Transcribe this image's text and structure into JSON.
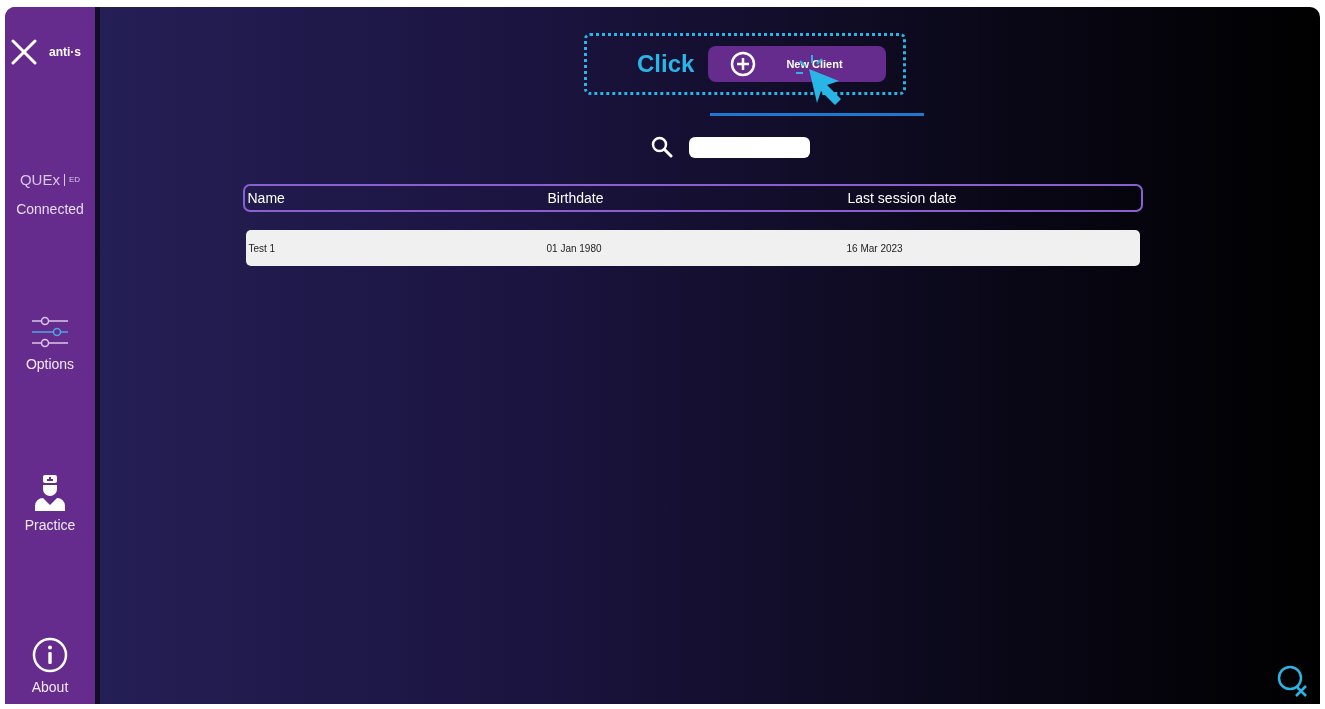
{
  "sidebar": {
    "brand": "anti·s",
    "device": {
      "logo": "QUEx",
      "edition": "ED",
      "status": "Connected"
    },
    "items": [
      {
        "kind": "options",
        "label": "Options"
      },
      {
        "kind": "practice",
        "label": "Practice"
      },
      {
        "kind": "about",
        "label": "About"
      }
    ]
  },
  "callout": {
    "label": "Click",
    "button": "New Client"
  },
  "table": {
    "columns": [
      "Name",
      "Birthdate",
      "Last session date"
    ],
    "rows": [
      [
        "Test 1",
        "01 Jan 1980",
        "16 Mar 2023"
      ]
    ]
  }
}
